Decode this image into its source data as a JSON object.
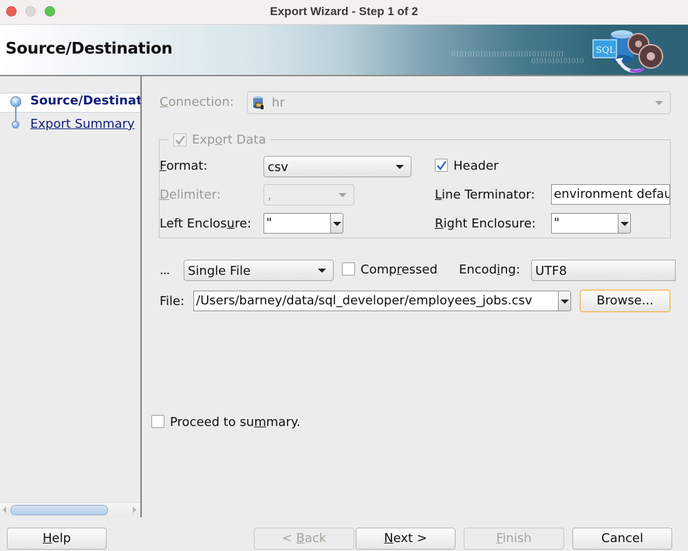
{
  "window": {
    "title": "Export Wizard - Step 1 of 2"
  },
  "banner": {
    "title": "Source/Destination",
    "binary_line1": "0101010101010101010101010101",
    "binary_line2": "0101010101010",
    "icon": "sql-export-icon"
  },
  "nav": {
    "items": [
      {
        "label": "Source/Destination",
        "state": "current"
      },
      {
        "label": "Export Summary",
        "state": "link"
      }
    ],
    "scrollbar": {
      "thumb_fraction": 0.78,
      "position_fraction": 0.0
    }
  },
  "form": {
    "connection": {
      "label": "Connection:",
      "mnemonic": "C",
      "rest": "onnection:",
      "value": "hr",
      "icon": "database-connection-icon",
      "enabled": false
    },
    "export_data": {
      "label_pre": "Exp",
      "mnemonic": "o",
      "label_post": "rt Data",
      "checked": true,
      "enabled": false
    },
    "format": {
      "mnemonic": "F",
      "rest": "ormat:",
      "value": "csv"
    },
    "header": {
      "label": "Header",
      "checked": true
    },
    "delimiter": {
      "mnemonic": "D",
      "rest": "elimiter:",
      "value": ",",
      "enabled": false
    },
    "line_terminator": {
      "mnemonic": "L",
      "rest": "ine Terminator:",
      "value": "environment default"
    },
    "left_enclosure": {
      "pre": "Left Enclos",
      "mnemonic": "u",
      "post": "re:",
      "value": "\""
    },
    "right_enclosure": {
      "mnemonic": "R",
      "rest": "ight Enclosure:",
      "value": "\""
    },
    "save_as": {
      "label": "...",
      "value": "Single File"
    },
    "compressed": {
      "pre": "Comp",
      "mnemonic": "r",
      "post": "essed",
      "checked": false
    },
    "encoding": {
      "pre": "Encod",
      "mnemonic": "i",
      "post": "ng:",
      "value": "UTF8"
    },
    "file": {
      "label": "File:",
      "value": "/Users/barney/data/sql_developer/employees_jobs.csv"
    },
    "browse_label": "Browse...",
    "proceed": {
      "pre": "Proceed to su",
      "mnemonic": "m",
      "post": "mary.",
      "checked": false
    }
  },
  "buttons": {
    "help": {
      "mnemonic": "H",
      "rest": "elp",
      "enabled": true
    },
    "back": {
      "pre": "< ",
      "mnemonic": "B",
      "rest": "ack",
      "enabled": false
    },
    "next": {
      "mnemonic": "N",
      "rest": "ext >",
      "enabled": true
    },
    "finish": {
      "mnemonic": "F",
      "rest": "inish",
      "enabled": false
    },
    "cancel": {
      "label": "Cancel",
      "enabled": true
    }
  },
  "colors": {
    "nav_link": "#0f1f7a",
    "checkmark": "#2f6ad0",
    "focus_ring": "#f1b454",
    "disabled_text": "#9a9a92"
  }
}
